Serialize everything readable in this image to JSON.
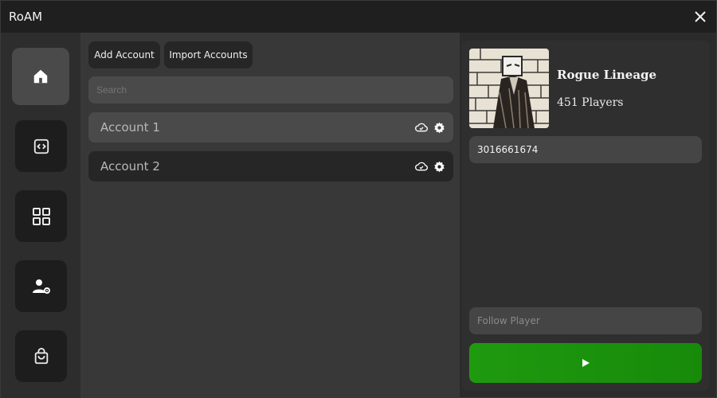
{
  "app": {
    "title": "RoAM"
  },
  "sidebar": {
    "items": [
      {
        "name": "home",
        "icon": "home-icon"
      },
      {
        "name": "script",
        "icon": "code-icon"
      },
      {
        "name": "apps",
        "icon": "grid-icon"
      },
      {
        "name": "account-settings",
        "icon": "user-gear-icon"
      },
      {
        "name": "shop",
        "icon": "shopping-bag-icon"
      }
    ]
  },
  "toolbar": {
    "add_account_label": "Add Account",
    "import_accounts_label": "Import Accounts"
  },
  "search": {
    "placeholder": "Search",
    "value": ""
  },
  "accounts": [
    {
      "name": "Account 1"
    },
    {
      "name": "Account 2"
    }
  ],
  "game": {
    "name": "Rogue Lineage",
    "players": "451 Players",
    "place_id": "3016661674"
  },
  "follow": {
    "placeholder": "Follow Player",
    "value": ""
  },
  "colors": {
    "play_button": "#1f9a0f",
    "active_nav": "#4a4a4a"
  }
}
